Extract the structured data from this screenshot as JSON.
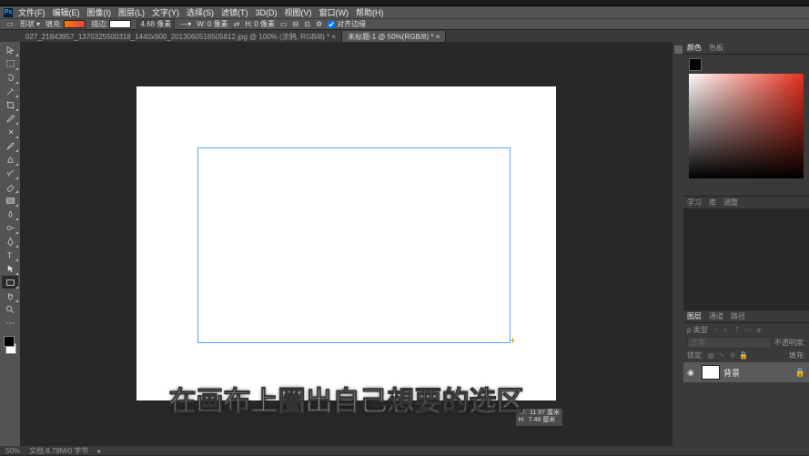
{
  "menu": {
    "items": [
      "文件(F)",
      "编辑(E)",
      "图像(I)",
      "图层(L)",
      "文字(Y)",
      "选择(S)",
      "滤镜(T)",
      "3D(D)",
      "视图(V)",
      "窗口(W)",
      "帮助(H)"
    ]
  },
  "options": {
    "shape_label": "形状",
    "fill_label": "填充:",
    "stroke_label": "描边:",
    "stroke_width": "4.68 像素",
    "w_label": "W:",
    "w_value": "0 像素",
    "h_label": "H:",
    "h_value": "0 像素",
    "align_label": "对齐边缘"
  },
  "tabs": [
    {
      "label": "027_21843957_1370325500318_1440x900_2013060516505812.jpg @ 100% (涂鸦, RGB/8) *",
      "active": false
    },
    {
      "label": "未标题-1 @ 50%(RGB/8) *",
      "active": true
    }
  ],
  "selection_tooltip": {
    "w": "W:  11.97 厘米",
    "h": "H:  7.48 厘米"
  },
  "subtitle": "在画布上圈出自己想要的选区",
  "panels": {
    "color_tabs": [
      "颜色",
      "色板"
    ],
    "learn_tabs": [
      "学习",
      "库",
      "调整"
    ],
    "layers_tabs": [
      "图层",
      "通道",
      "路径"
    ],
    "blend_mode": "正常",
    "opacity_label": "不透明度:",
    "fill_label": "填充:",
    "lock_label": "锁定:",
    "layer_name": "背景"
  },
  "status": {
    "zoom": "50%",
    "doc": "文档:8.78M/0 字节"
  }
}
